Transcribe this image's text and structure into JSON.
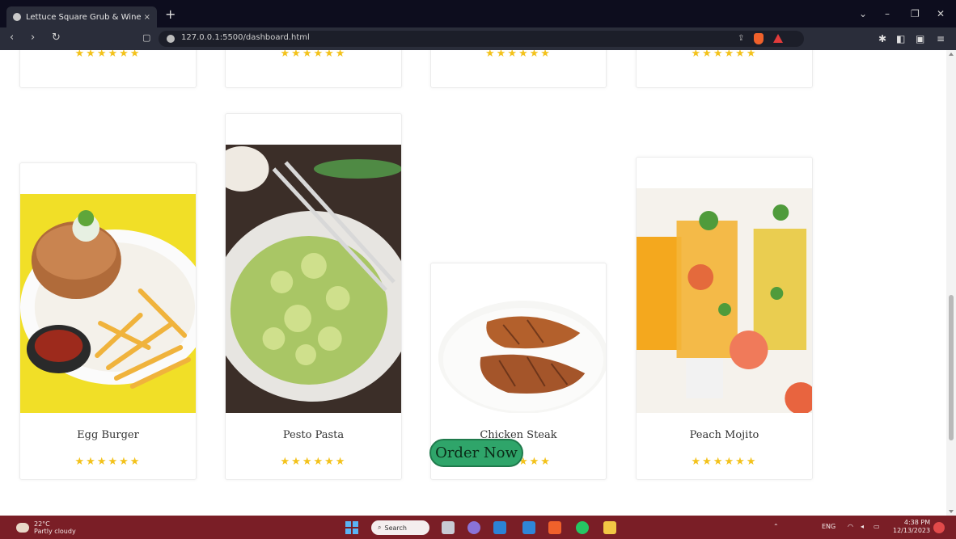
{
  "browser": {
    "tab_title": "Lettuce Square Grub & Wine",
    "tab_close": "×",
    "new_tab": "+",
    "window_controls": [
      "⌄",
      "–",
      "❐",
      "✕"
    ],
    "nav": [
      "‹",
      "›",
      "↻"
    ],
    "url": "127.0.0.1:5500/dashboard.html"
  },
  "top_row": {
    "stars": [
      "★★★★★★",
      "★★★★★★",
      "★★★★★★",
      "★★★★★★"
    ]
  },
  "menu_items": [
    {
      "name": "Egg Burger",
      "stars": "★★★★★★"
    },
    {
      "name": "Pesto Pasta",
      "stars": "★★★★★★"
    },
    {
      "name": "Chicken Steak",
      "stars": "★★★★★★"
    },
    {
      "name": "Peach Mojito",
      "stars": "★★★★★★"
    }
  ],
  "order_button": "Order Now",
  "taskbar": {
    "weather_temp": "22°C",
    "weather_desc": "Partly cloudy",
    "search_placeholder": "Search",
    "tray_lang": "ENG",
    "tray_time": "4:38 PM",
    "tray_date": "12/13/2023"
  },
  "colors": {
    "star": "#f3c21b",
    "order_button": "#2fa56a",
    "taskbar": "#7a1e26",
    "browser_chrome": "#0d0d1e"
  }
}
